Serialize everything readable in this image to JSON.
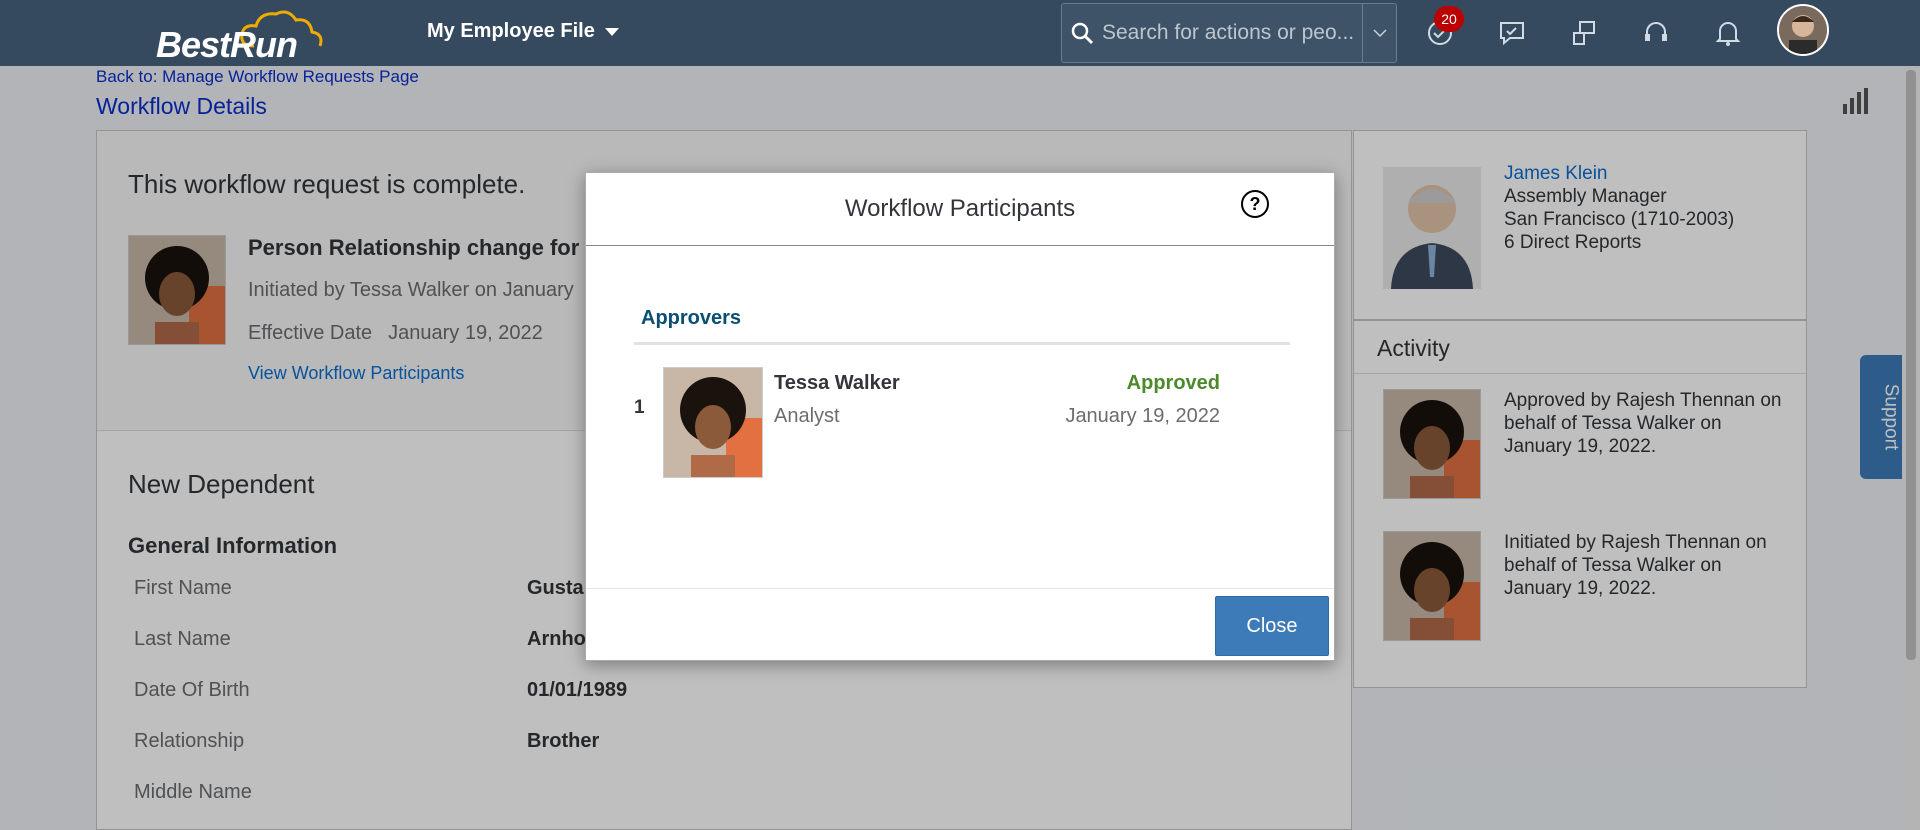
{
  "shell": {
    "logo_best": "Best",
    "logo_run": "Run",
    "menu_title": "My Employee File",
    "search_placeholder": "Search for actions or peo...",
    "notification_count": "20"
  },
  "page": {
    "back_link": "Back to: Manage Workflow Requests Page",
    "title": "Workflow Details"
  },
  "request": {
    "status_text": "This workflow request is complete.",
    "title": "Person Relationship change for",
    "initiated": "Initiated by Tessa Walker on January",
    "effective_label": "Effective Date",
    "effective_value": "January 19, 2022",
    "view_participants": "View Workflow Participants"
  },
  "dependent": {
    "section_title": "New Dependent",
    "group_title": "General Information",
    "fields": [
      {
        "label": "First Name",
        "value": "Gusta"
      },
      {
        "label": "Last Name",
        "value": "Arnho"
      },
      {
        "label": "Date Of Birth",
        "value": "01/01/1989"
      },
      {
        "label": "Relationship",
        "value": "Brother"
      },
      {
        "label": "Middle Name",
        "value": ""
      }
    ]
  },
  "manager": {
    "name": "James Klein",
    "title": "Assembly Manager",
    "location": "San Francisco (1710-2003)",
    "reports": "6 Direct Reports"
  },
  "activity": {
    "title": "Activity",
    "items": [
      {
        "text": "Approved by Rajesh Thennan on behalf of Tessa Walker on January 19, 2022."
      },
      {
        "text": "Initiated by Rajesh Thennan on behalf of Tessa Walker on January 19, 2022."
      }
    ]
  },
  "support_label": "Support",
  "dialog": {
    "title": "Workflow Participants",
    "help": "?",
    "section": "Approvers",
    "participants": [
      {
        "index": "1",
        "name": "Tessa Walker",
        "role": "Analyst",
        "status": "Approved",
        "date": "January 19, 2022"
      }
    ],
    "close_label": "Close"
  },
  "colors": {
    "shell": "#354a5f",
    "link": "#0a6ed1",
    "approved": "#4b8a2b",
    "primary_button": "#3d7ab8"
  }
}
